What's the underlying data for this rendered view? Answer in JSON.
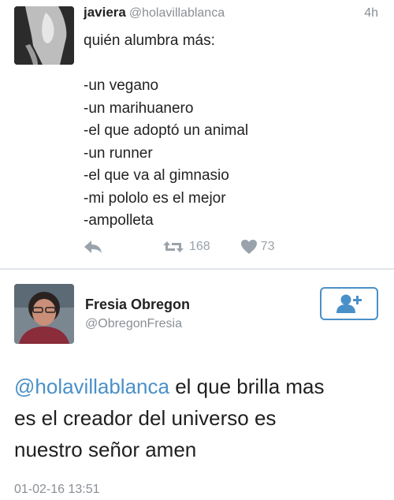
{
  "tweet1": {
    "name": "javiera",
    "handle": "@holavillablanca",
    "time": "4h",
    "lines": [
      "quién alumbra más:",
      "",
      "-un vegano",
      "-un marihuanero",
      "-el que adoptó un animal",
      "-un runner",
      "-el que va al gimnasio",
      "-mi pololo es el mejor",
      "-ampolleta"
    ],
    "retweets": "168",
    "likes": "73",
    "icons": {
      "reply": "reply-icon",
      "retweet": "retweet-icon",
      "like": "heart-icon"
    }
  },
  "tweet2": {
    "name": "Fresia Obregon",
    "handle": "@ObregonFresia",
    "mention": "@holavillablanca",
    "line1_rest": " el que brilla mas",
    "line2": "es el creador del universo es",
    "line3": "nuestro señor amen",
    "date": "01-02-16 13:51",
    "follow_icon": "add-user-icon"
  },
  "colors": {
    "link": "#4a90c8",
    "meta": "#8a8f95",
    "action": "#9aa3ab"
  }
}
